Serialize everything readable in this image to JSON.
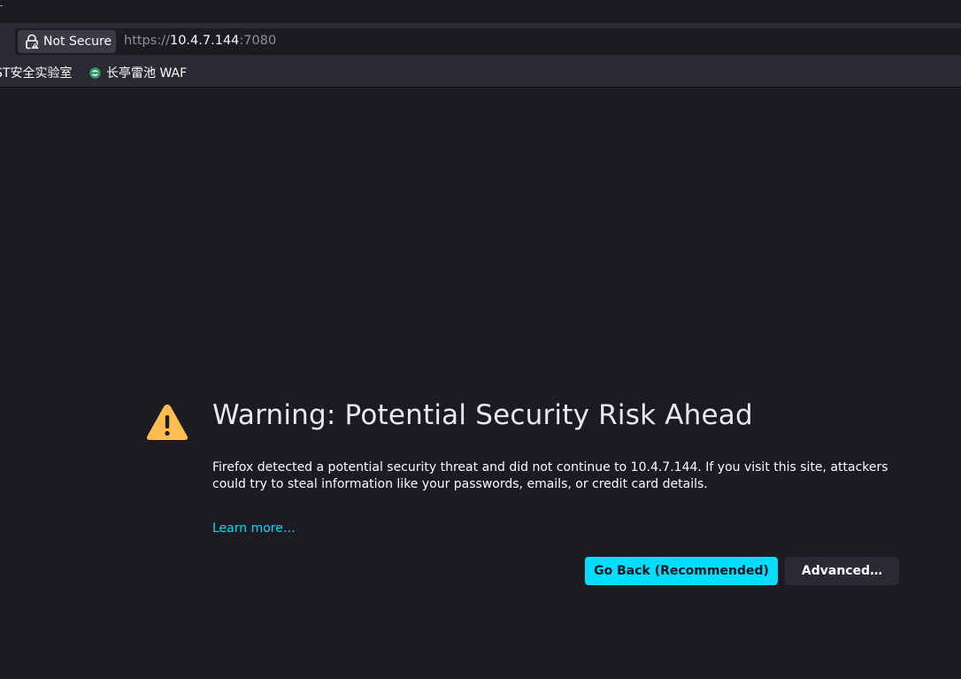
{
  "colors": {
    "page_bg": "#1c1b22",
    "toolbar_bg": "#2b2a33",
    "accent": "#00ddff",
    "warning": "#ffbd4f"
  },
  "urlbar": {
    "identity_label": "Not Secure",
    "url_scheme": "https://",
    "url_host": "10.4.7.144",
    "url_port": ":7080",
    "identity_icon": "insecure-lock-icon"
  },
  "bookmarks": [
    {
      "label": "ST安全实验室"
    },
    {
      "label": "长亭雷池 WAF",
      "icon": "waf-favicon-icon"
    }
  ],
  "error_page": {
    "icon": "warning-icon",
    "title": "Warning: Potential Security Risk Ahead",
    "description": "Firefox detected a potential security threat and did not continue to 10.4.7.144. If you visit this site, attackers could try to steal information like your passwords, emails, or credit card details.",
    "learn_more": "Learn more…",
    "go_back_label": "Go Back (Recommended)",
    "advanced_label": "Advanced…"
  }
}
